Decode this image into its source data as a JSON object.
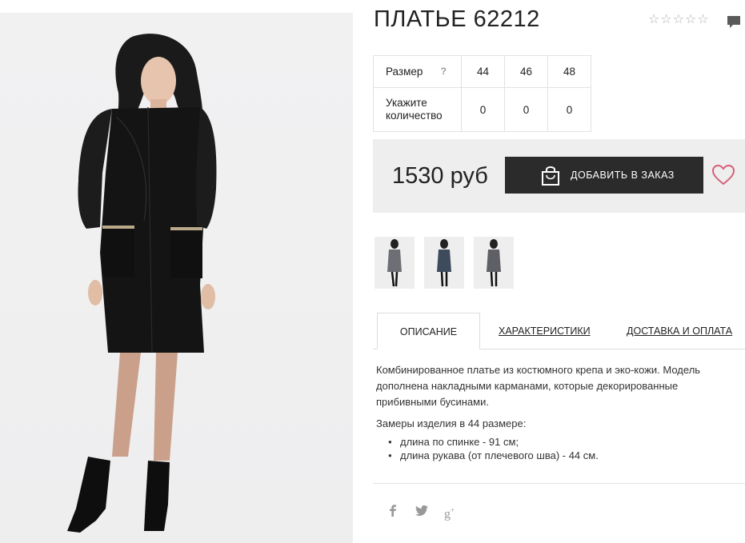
{
  "product": {
    "title": "ПЛАТЬЕ 62212",
    "rating_stars": 5
  },
  "sizes": {
    "size_label": "Размер",
    "help_symbol": "?",
    "qty_label": "Укажите количество",
    "columns": [
      {
        "size": "44",
        "qty": "0"
      },
      {
        "size": "46",
        "qty": "0"
      },
      {
        "size": "48",
        "qty": "0"
      }
    ]
  },
  "price": {
    "value": "1530 руб",
    "order_label": "ДОБАВИТЬ В ЗАКАЗ"
  },
  "thumbnails": [
    "thumb-1",
    "thumb-2",
    "thumb-3"
  ],
  "tabs": [
    {
      "label": "ОПИСАНИЕ",
      "active": true
    },
    {
      "label": "ХАРАКТЕРИСТИКИ",
      "active": false
    },
    {
      "label": "ДОСТАВКА И ОПЛАТА",
      "active": false
    }
  ],
  "description": {
    "text": "Комбинированное платье из костюмного крепа и эко-кожи. Модель дополнена накладными карманами, которые декорированные прибивными бусинами.",
    "measure_title": "Замеры изделия в 44 размере:",
    "bullets": [
      "длина по спинке - 91 см;",
      "длина рукава (от плечевого шва) - 44 см."
    ]
  },
  "social": [
    "facebook-icon",
    "twitter-icon",
    "google-plus-icon"
  ],
  "colors": {
    "button_bg": "#2b2b2b",
    "price_box_bg": "#eeeeee",
    "heart": "#d4607a"
  }
}
